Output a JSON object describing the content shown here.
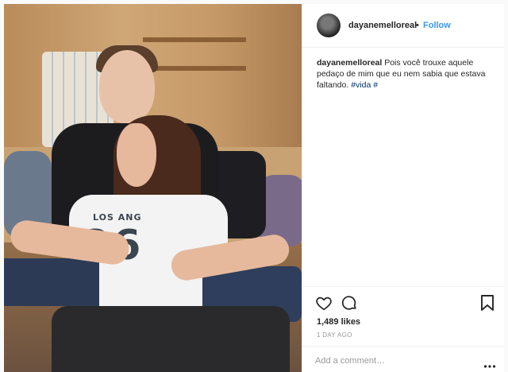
{
  "post": {
    "username": "dayanemelloreal",
    "separator": "•",
    "follow_label": "Follow",
    "caption": {
      "username": "dayanemelloreal",
      "text": " Pois você trouxe aquele pedaço de mim que eu nem sabia que estava faltando. ",
      "hashtag": "#vida",
      "trailing": " #"
    },
    "likes": "1,489 likes",
    "time": "1 DAY AGO",
    "comment_placeholder": "Add a comment…",
    "photo_text": {
      "shirt_line": "LOS ANG",
      "shirt_number": "26"
    }
  },
  "icons": {
    "like": "heart-icon",
    "comment": "comment-icon",
    "save": "bookmark-icon",
    "options": "more-icon"
  },
  "colors": {
    "follow": "#3897f0",
    "hashtag": "#003569",
    "text": "#262626",
    "muted": "#999999"
  }
}
